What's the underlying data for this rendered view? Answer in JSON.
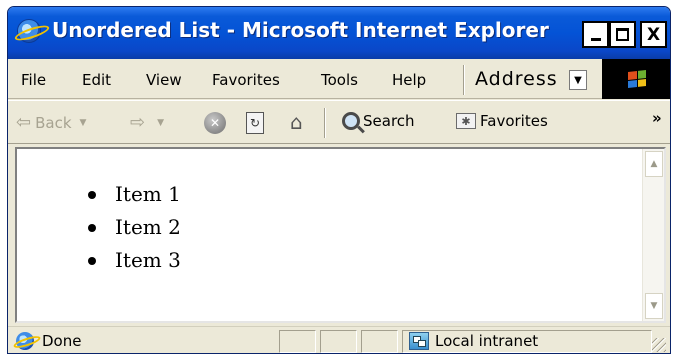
{
  "window": {
    "title": "Unordered List - Microsoft Internet Explorer",
    "controls": {
      "minimize_icon": "minimize-icon",
      "maximize_icon": "maximize-icon",
      "close_label": "X"
    }
  },
  "menubar": {
    "items": [
      "File",
      "Edit",
      "View",
      "Favorites",
      "Tools",
      "Help"
    ],
    "address_label": "Address"
  },
  "toolbar": {
    "back_label": "Back",
    "search_label": "Search",
    "favorites_label": "Favorites",
    "chevron": "»"
  },
  "content": {
    "list_items": [
      "Item 1",
      "Item 2",
      "Item 3"
    ]
  },
  "statusbar": {
    "status_text": "Done",
    "zone_text": "Local intranet"
  },
  "colors": {
    "titlebar": "#0453d6",
    "chrome": "#ece9d8"
  }
}
